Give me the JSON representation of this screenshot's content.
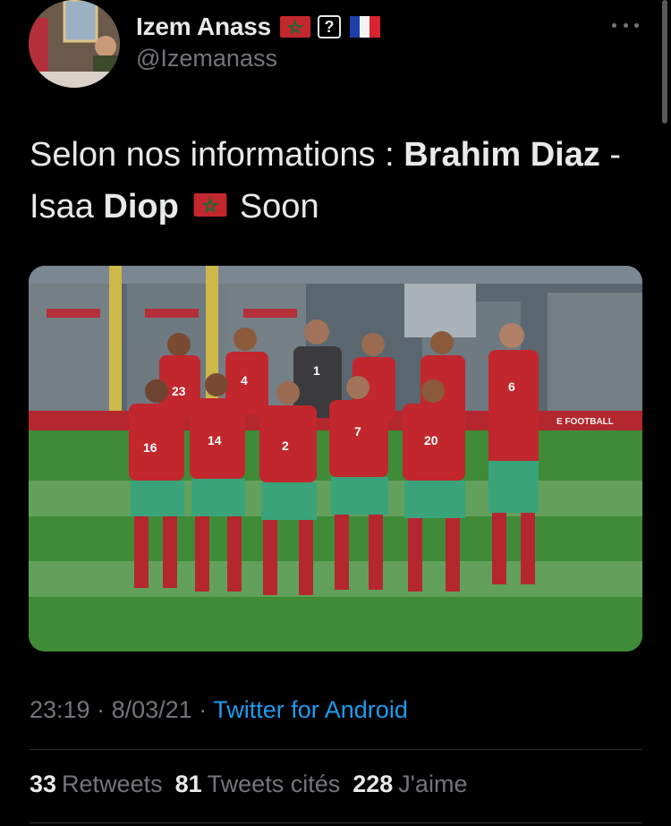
{
  "author": {
    "display_name": "Izem Anass",
    "handle": "@Izemanass",
    "name_emojis": [
      "morocco-flag",
      "unknown-emoji",
      "france-flag"
    ],
    "unknown_emoji_glyph": "?"
  },
  "tweet": {
    "text_parts": {
      "prefix": "Selon nos informations : ",
      "name1_bold": "Brahim Diaz",
      "sep": " - Isaa ",
      "name2_bold": "Diop",
      "suffix": "Soon"
    },
    "inline_emoji": "morocco-flag",
    "image_alt": "Morocco national football team photo",
    "jersey_numbers": [
      "23",
      "4",
      "1",
      "6",
      "16",
      "14",
      "2",
      "7",
      "20"
    ]
  },
  "meta": {
    "time": "23:19",
    "date": "8/03/21",
    "separator": "·",
    "source": "Twitter for Android"
  },
  "stats": {
    "retweets_count": "33",
    "retweets_label": "Retweets",
    "quotes_count": "81",
    "quotes_label": "Tweets cités",
    "likes_count": "228",
    "likes_label": "J'aime"
  },
  "colors": {
    "background": "#000000",
    "text_primary": "#e7e9ea",
    "text_secondary": "#71767b",
    "link": "#1d9bf0",
    "jersey_red": "#c1272d",
    "shorts_green": "#3aa37a",
    "pitch_green": "#3f8b38"
  },
  "pitch_board_text": "E FOOTBALL"
}
